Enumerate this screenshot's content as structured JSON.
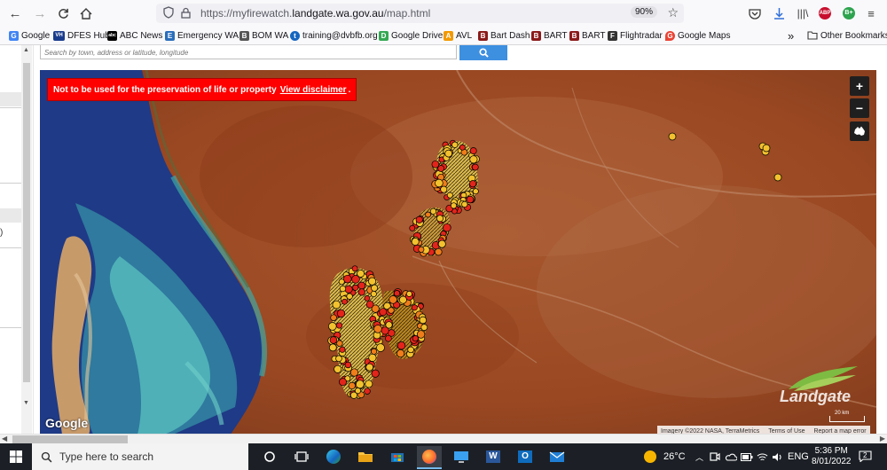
{
  "browser": {
    "url_prefix": "https://myfirewatch.",
    "url_domain": "landgate.wa.gov.au",
    "url_path": "/map.html",
    "zoom": "90%",
    "bookmarks": [
      {
        "label": "Google",
        "fav": "G",
        "color": "#4285f4"
      },
      {
        "label": "DFES Hub",
        "fav": "VH",
        "color": "#1a3c8c"
      },
      {
        "label": "ABC News",
        "fav": "abc",
        "color": "#000000"
      },
      {
        "label": "Emergency WA",
        "fav": "E",
        "color": "#2a6ebb"
      },
      {
        "label": "BOM WA",
        "fav": "B",
        "color": "#555555"
      },
      {
        "label": "training@dvbfb.org",
        "fav": "t",
        "color": "#1565c0"
      },
      {
        "label": "Google Drive",
        "fav": "D",
        "color": "#34a853"
      },
      {
        "label": "AVL",
        "fav": "A",
        "color": "#f29900"
      },
      {
        "label": "Bart Dash",
        "fav": "B",
        "color": "#8b1a1a"
      },
      {
        "label": "BART",
        "fav": "B",
        "color": "#8b1a1a"
      },
      {
        "label": "BART",
        "fav": "B",
        "color": "#8b1a1a"
      },
      {
        "label": "Flightradar",
        "fav": "F",
        "color": "#333333"
      },
      {
        "label": "Google Maps",
        "fav": "G",
        "color": "#ea4335"
      }
    ],
    "overflow_label": "»",
    "other_bookmarks": "Other Bookmarks"
  },
  "page": {
    "search_placeholder": "Search by town, address or latitude, longitude",
    "left_panel_fragment": ")"
  },
  "map": {
    "disclaimer_text": "Not to be used for the preservation of life or property",
    "disclaimer_link": "View disclaimer",
    "disclaimer_end": ".",
    "zoom_in": "+",
    "zoom_out": "−",
    "google": "Google",
    "imagery": "Imagery ©2022 NASA, TerraMetrics",
    "terms": "Terms of Use",
    "report": "Report a map error",
    "landgate": "Landgate",
    "scale": "20 km"
  },
  "taskbar": {
    "search_placeholder": "Type here to search",
    "temperature": "26°C",
    "language": "ENG",
    "time": "5:36 PM",
    "date": "8/01/2022",
    "notifications": "2"
  }
}
